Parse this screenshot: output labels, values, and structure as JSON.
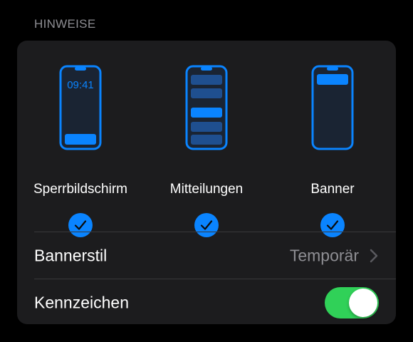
{
  "section": {
    "title": "HINWEISE"
  },
  "alerts": [
    {
      "label": "Sperrbildschirm",
      "time": "09:41",
      "checked": true,
      "icon": "lock-screen-phone-icon"
    },
    {
      "label": "Mitteilungen",
      "checked": true,
      "icon": "notification-center-phone-icon"
    },
    {
      "label": "Banner",
      "checked": true,
      "icon": "banner-phone-icon"
    }
  ],
  "banner_style": {
    "label": "Bannerstil",
    "value": "Temporär"
  },
  "badges": {
    "label": "Kennzeichen",
    "enabled": true
  },
  "colors": {
    "accent": "#0a84ff",
    "toggle_on": "#30d158",
    "card": "#1c1c1e",
    "secondary_text": "#8e8e93"
  }
}
